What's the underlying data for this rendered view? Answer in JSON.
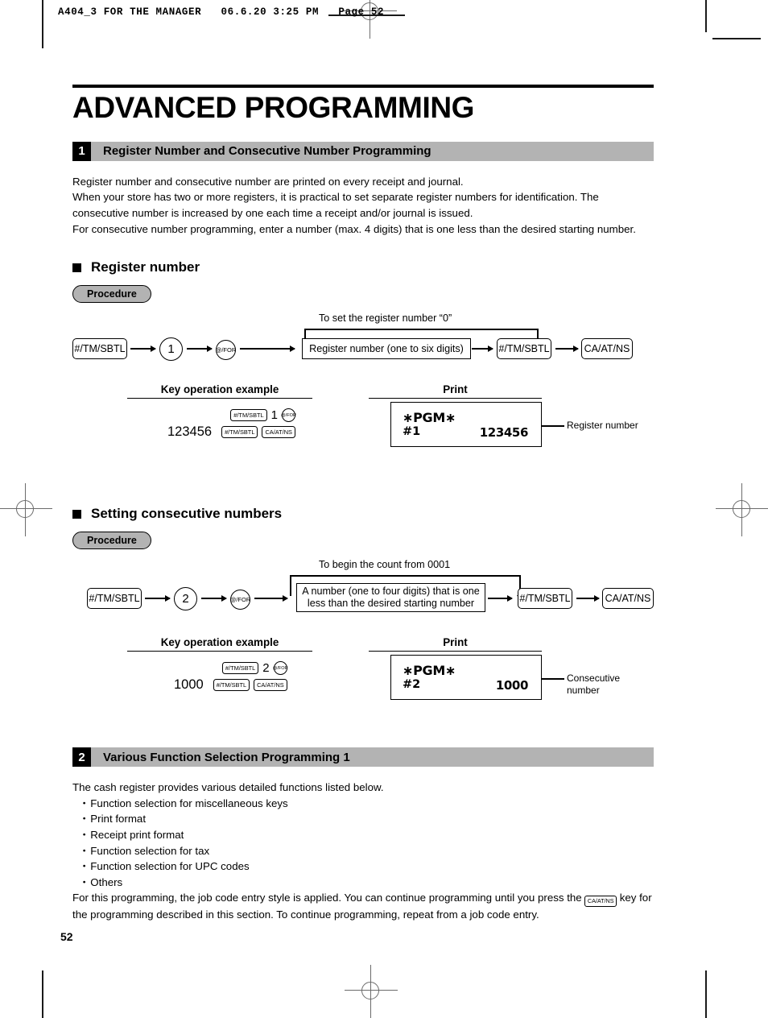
{
  "page_slug": "A404_3 FOR THE MANAGER   06.6.20 3:25 PM   Page 52",
  "page_number": "52",
  "chapter_title": "ADVANCED PROGRAMMING",
  "sections": [
    {
      "number": "1",
      "title": "Register Number and Consecutive Number Programming",
      "paragraphs": [
        "Register number and consecutive number are printed on every receipt and journal.",
        "When your store has two or more registers, it is practical to set separate register numbers for identification.  The consecutive number is increased by one each time a receipt and/or journal is issued.",
        "For consecutive number programming, enter a number (max. 4 digits) that is one less than the desired starting number."
      ]
    },
    {
      "number": "2",
      "title": "Various Function Selection Programming 1",
      "intro": "The cash register provides various detailed functions listed below.",
      "bullets": [
        "Function selection for miscellaneous keys",
        "Print format",
        "Receipt print format",
        "Function selection for tax",
        "Function selection for UPC codes",
        "Others"
      ],
      "outro_part1": "For this programming, the job code entry style is applied.  You can continue programming until you press the",
      "outro_key": "CA/AT/NS",
      "outro_part2": "key for the programming described in this section.  To continue programming, repeat from a job code entry."
    }
  ],
  "procedure_label": "Procedure",
  "subsections": [
    {
      "heading": "Register number",
      "flow": {
        "bypass_label": "To set the register number “0”",
        "key1": "#/TM/SBTL",
        "digit": "1",
        "key2": "@/FOR",
        "box_text": "Register number (one to six digits)",
        "key3": "#/TM/SBTL",
        "key4": "CA/AT/NS"
      },
      "example": {
        "heading": "Key operation example",
        "row1_key": "#/TM/SBTL",
        "row1_digit": "1",
        "row1_circle": "@/FOR",
        "row2_amount": "123456",
        "row2_key1": "#/TM/SBTL",
        "row2_key2": "CA/AT/NS"
      },
      "print": {
        "heading": "Print",
        "line1": "∗PGM∗",
        "line2_left": "#1",
        "line2_right": "123456",
        "callout": "Register number"
      }
    },
    {
      "heading": "Setting consecutive numbers",
      "flow": {
        "bypass_label": "To begin the count from 0001",
        "key1": "#/TM/SBTL",
        "digit": "2",
        "key2": "@/FOR",
        "box_text": "A number (one to four digits) that is one less than the desired starting number",
        "key3": "#/TM/SBTL",
        "key4": "CA/AT/NS"
      },
      "example": {
        "heading": "Key operation example",
        "row1_key": "#/TM/SBTL",
        "row1_digit": "2",
        "row1_circle": "@/FOR",
        "row2_amount": "1000",
        "row2_key1": "#/TM/SBTL",
        "row2_key2": "CA/AT/NS"
      },
      "print": {
        "heading": "Print",
        "line1": "∗PGM∗",
        "line2_left": "#2",
        "line2_right": "1000",
        "callout": "Consecutive number"
      }
    }
  ],
  "colors": {
    "section_bar": "#b3b3b3",
    "section_num_bg": "#000000",
    "pill_bg": "#b3b3b3",
    "ink": "#000000",
    "regmark": "#6b6b6b"
  }
}
